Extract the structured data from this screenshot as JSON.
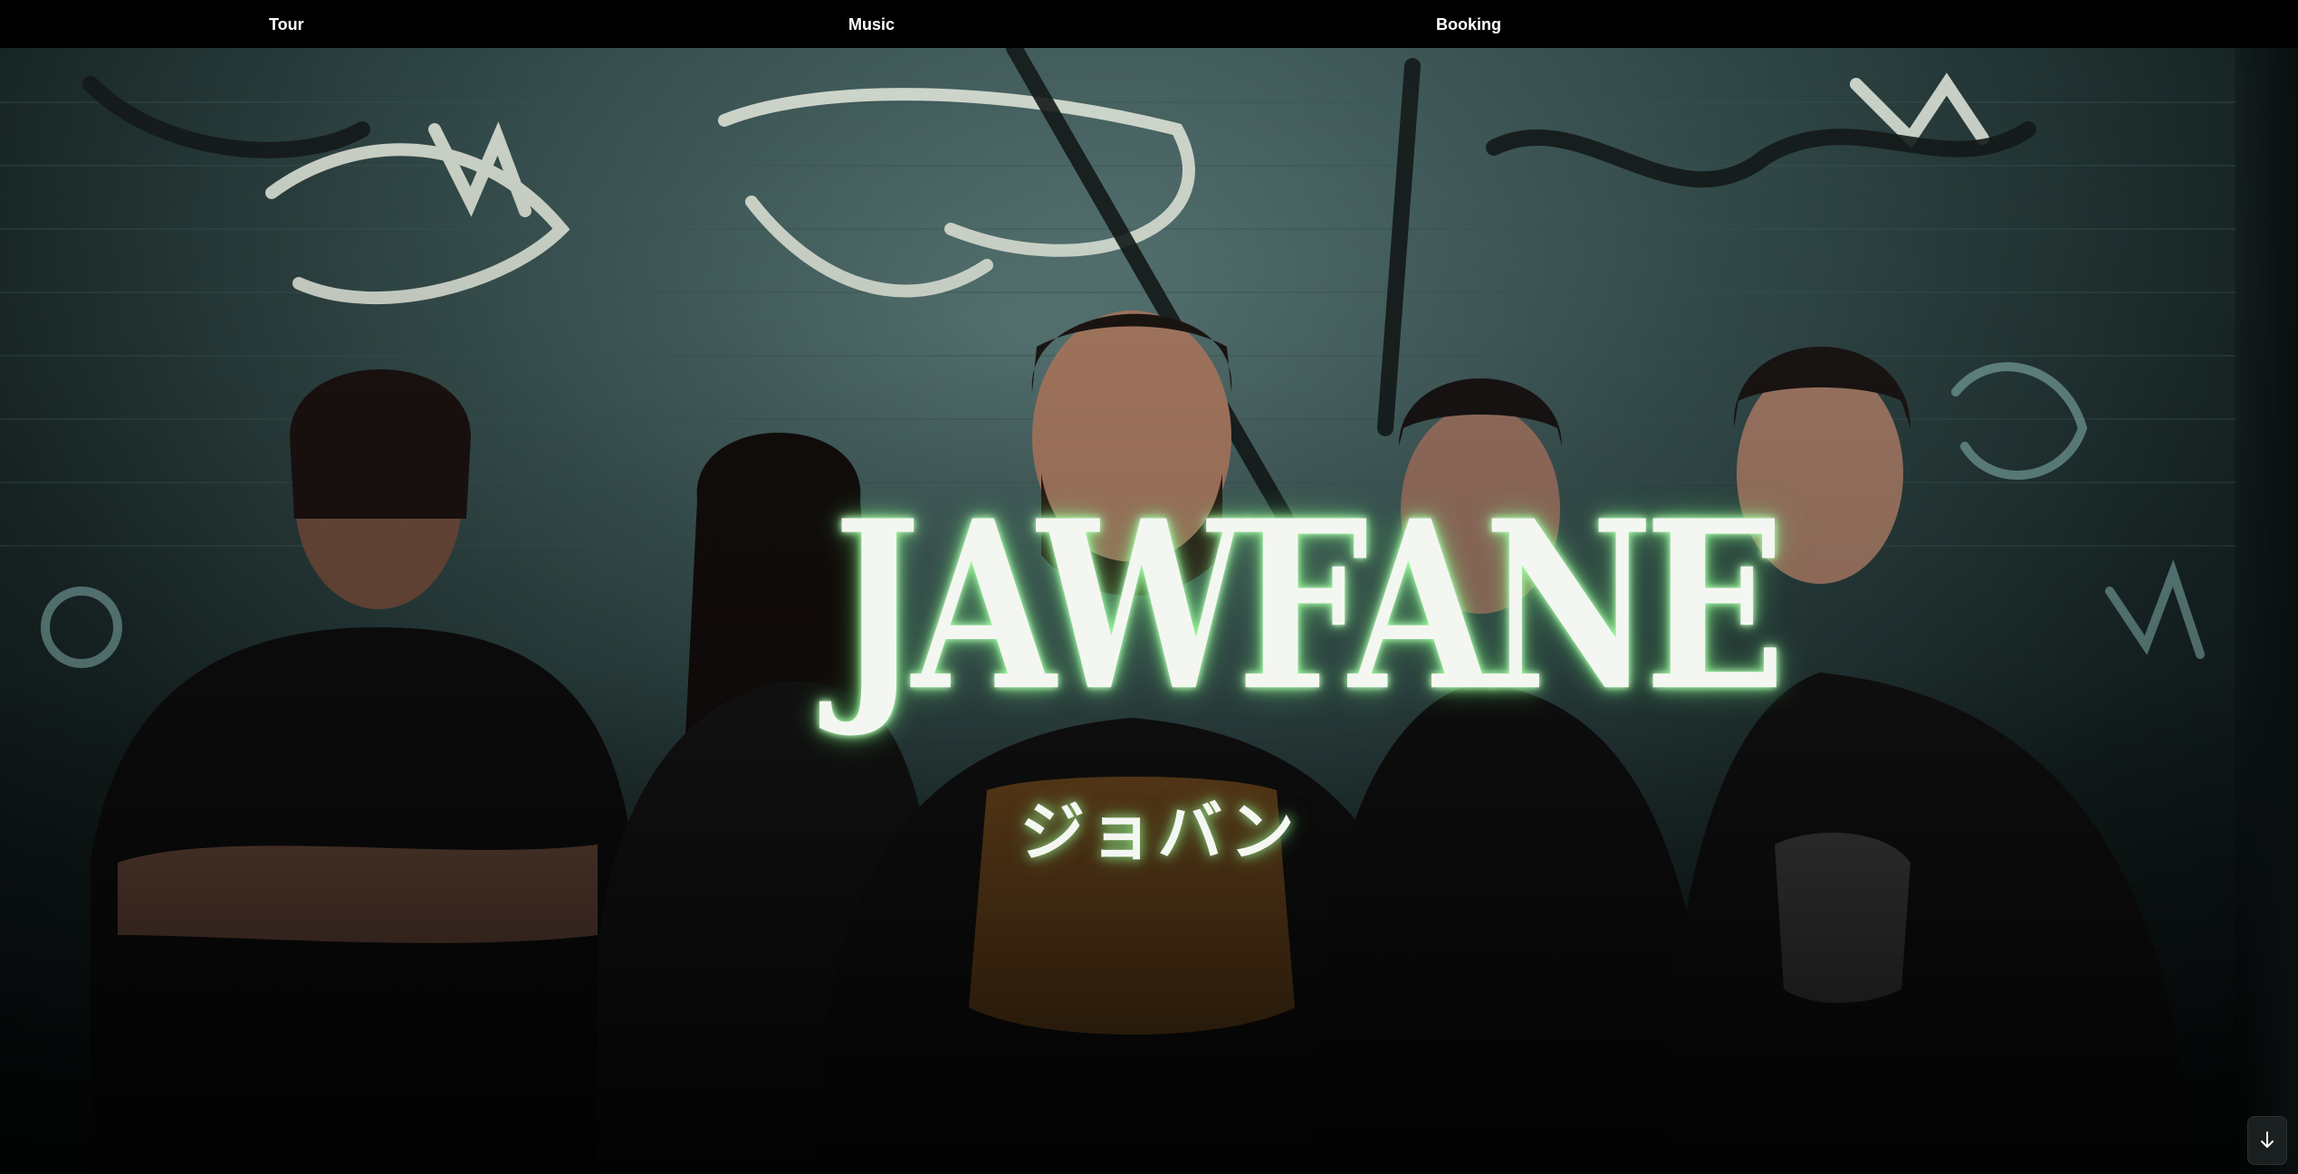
{
  "nav": {
    "items": [
      {
        "label": "Tour"
      },
      {
        "label": "Music"
      },
      {
        "label": "Booking"
      }
    ]
  },
  "hero": {
    "logo_text": "JAWFANE",
    "logo_subtitle": "ジョバン",
    "glow_color": "#9cff9c"
  },
  "scroll_button": {
    "icon": "arrow-down-icon"
  }
}
